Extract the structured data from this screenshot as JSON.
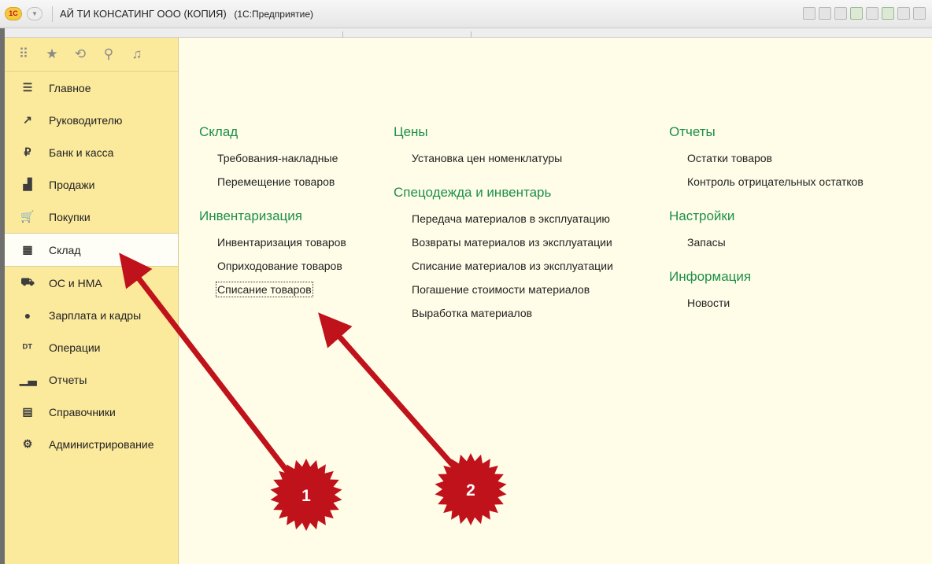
{
  "app": {
    "logo_text": "1С",
    "title": "АЙ ТИ КОНСАТИНГ ООО (КОПИЯ)",
    "subtitle": "(1С:Предприятие)"
  },
  "quick_panel": {
    "icons": [
      "apps-grid-icon",
      "star-icon",
      "history-icon",
      "search-icon",
      "bell-icon"
    ]
  },
  "sidebar": {
    "items": [
      {
        "label": "Главное",
        "icon": "menu-lines-icon",
        "glyph": "☰"
      },
      {
        "label": "Руководителю",
        "icon": "trend-icon",
        "glyph": "↗"
      },
      {
        "label": "Банк и касса",
        "icon": "ruble-coin-icon",
        "glyph": "₽"
      },
      {
        "label": "Продажи",
        "icon": "bag-icon",
        "glyph": "▟"
      },
      {
        "label": "Покупки",
        "icon": "cart-icon",
        "glyph": "🛒"
      },
      {
        "label": "Склад",
        "icon": "warehouse-icon",
        "glyph": "▦",
        "active": true
      },
      {
        "label": "ОС и НМА",
        "icon": "truck-icon",
        "glyph": "⛟"
      },
      {
        "label": "Зарплата и кадры",
        "icon": "person-icon",
        "glyph": "●"
      },
      {
        "label": "Операции",
        "icon": "dt-kt-icon",
        "glyph": "ᴰᵀ"
      },
      {
        "label": "Отчеты",
        "icon": "bar-chart-icon",
        "glyph": "▁▃"
      },
      {
        "label": "Справочники",
        "icon": "books-icon",
        "glyph": "▤"
      },
      {
        "label": "Администрирование",
        "icon": "gear-icon",
        "glyph": "⚙"
      }
    ]
  },
  "main": {
    "col1": {
      "sections": [
        {
          "title": "Склад",
          "links": [
            "Требования-накладные",
            "Перемещение товаров"
          ]
        },
        {
          "title": "Инвентаризация",
          "links": [
            "Инвентаризация товаров",
            "Оприходование товаров",
            "Списание товаров"
          ]
        }
      ]
    },
    "col2": {
      "sections": [
        {
          "title": "Цены",
          "links": [
            "Установка цен номенклатуры"
          ]
        },
        {
          "title": "Спецодежда и инвентарь",
          "links": [
            "Передача материалов в эксплуатацию",
            "Возвраты материалов из эксплуатации",
            "Списание материалов из эксплуатации",
            "Погашение стоимости материалов",
            "Выработка материалов"
          ]
        }
      ]
    },
    "col3": {
      "sections": [
        {
          "title": "Отчеты",
          "links": [
            "Остатки товаров",
            "Контроль отрицательных остатков"
          ]
        },
        {
          "title": "Настройки",
          "links": [
            "Запасы"
          ]
        },
        {
          "title": "Информация",
          "links": [
            "Новости"
          ]
        }
      ]
    }
  },
  "annotations": {
    "badge1": "1",
    "badge2": "2",
    "arrow_color": "#c0121b"
  }
}
